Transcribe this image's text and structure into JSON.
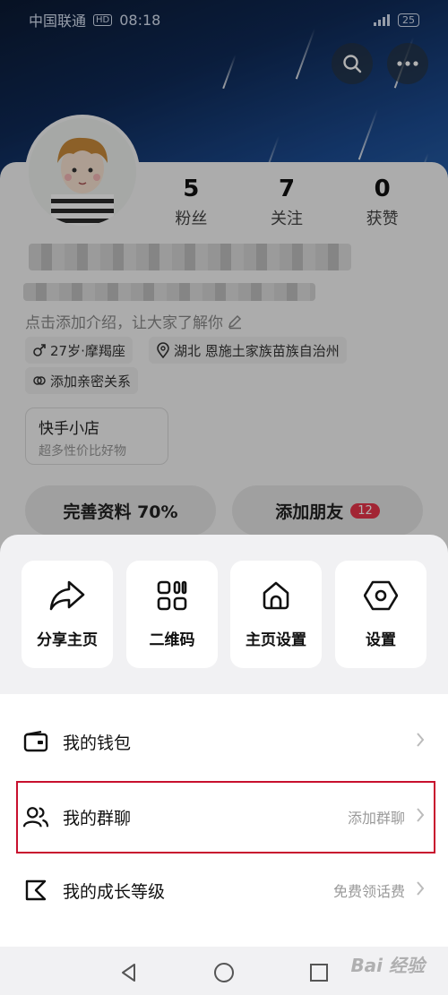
{
  "status_bar": {
    "carrier": "中国联通",
    "hd_badge": "HD",
    "time": "08:18",
    "battery": "25"
  },
  "header": {
    "search_icon": "search-icon",
    "more_icon": "more-horizontal-icon"
  },
  "profile": {
    "stats": [
      {
        "value": "5",
        "label": "粉丝"
      },
      {
        "value": "7",
        "label": "关注"
      },
      {
        "value": "0",
        "label": "获赞"
      }
    ],
    "intro_placeholder": "点击添加介绍，让大家了解你",
    "tags": {
      "age_sign": "27岁·摩羯座",
      "location": "湖北 恩施土家族苗族自治州",
      "relation": "添加亲密关系"
    },
    "shop": {
      "title": "快手小店",
      "subtitle": "超多性价比好物"
    },
    "complete_profile": "完善资料 70%",
    "add_friends": "添加朋友",
    "add_friends_badge": "12"
  },
  "sheet": {
    "tiles": [
      {
        "label": "分享主页",
        "icon": "share-icon"
      },
      {
        "label": "二维码",
        "icon": "qr-code-icon"
      },
      {
        "label": "主页设置",
        "icon": "home-icon"
      },
      {
        "label": "设置",
        "icon": "settings-icon"
      }
    ],
    "list": [
      {
        "label": "我的钱包",
        "hint": "",
        "icon": "wallet-icon"
      },
      {
        "label": "我的群聊",
        "hint": "添加群聊",
        "icon": "group-icon"
      },
      {
        "label": "我的成长等级",
        "hint": "免费领话费",
        "icon": "growth-level-icon"
      }
    ]
  },
  "watermark": "Bai 经验"
}
